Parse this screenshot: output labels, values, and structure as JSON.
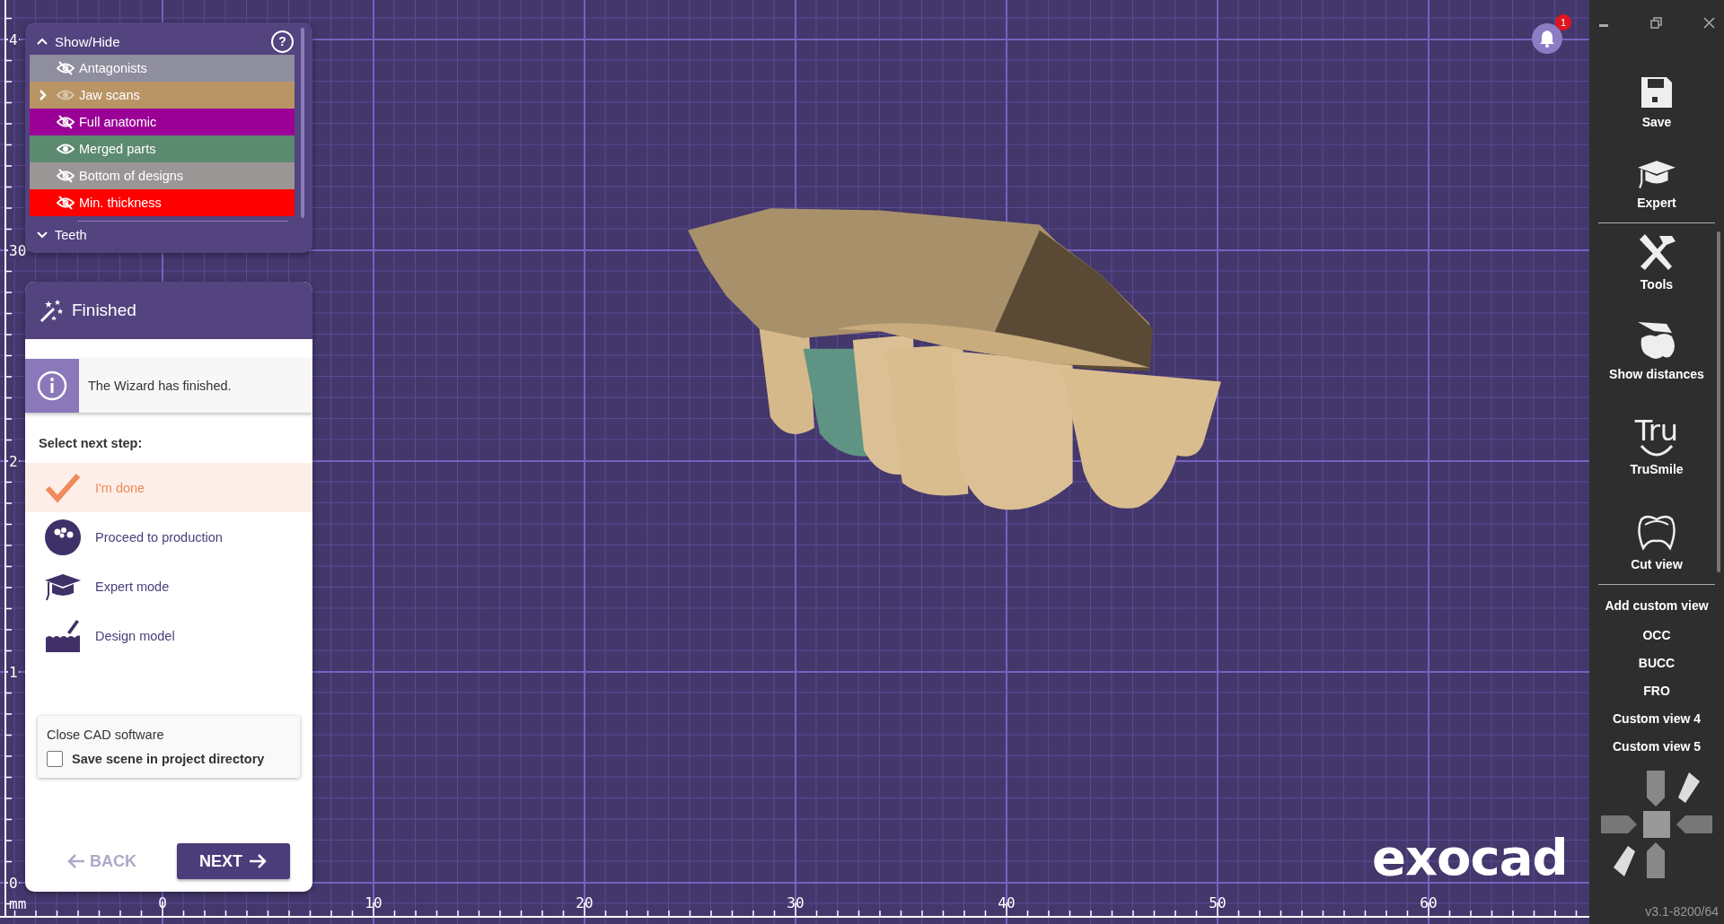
{
  "layers_panel": {
    "title": "Show/Hide",
    "expanded": true,
    "help_icon": "?",
    "items": [
      {
        "label": "Antagonists",
        "color": "#8e8e9e",
        "visible": false,
        "dimmed": false,
        "expandable": false
      },
      {
        "label": "Jaw scans",
        "color": "#b99566",
        "visible": true,
        "dimmed": true,
        "expandable": true
      },
      {
        "label": "Full anatomic",
        "color": "#9b0096",
        "visible": false,
        "dimmed": false,
        "expandable": false
      },
      {
        "label": "Merged parts",
        "color": "#5c8a70",
        "visible": true,
        "dimmed": false,
        "expandable": false
      },
      {
        "label": "Bottom of designs",
        "color": "#9a9696",
        "visible": false,
        "dimmed": false,
        "expandable": false
      },
      {
        "label": "Min. thickness",
        "color": "#ff0000",
        "visible": false,
        "dimmed": false,
        "expandable": false
      }
    ],
    "sections": [
      {
        "label": "Teeth",
        "expanded": false
      }
    ]
  },
  "wizard": {
    "title": "Finished",
    "info": "The Wizard has finished.",
    "prompt": "Select next step:",
    "options": [
      {
        "label": "I'm done",
        "kind": "done",
        "selected": true
      },
      {
        "label": "Proceed to production",
        "kind": "production",
        "selected": false
      },
      {
        "label": "Expert mode",
        "kind": "expert",
        "selected": false
      },
      {
        "label": "Design model",
        "kind": "design",
        "selected": false
      }
    ],
    "close_box": {
      "title": "Close CAD software",
      "checkbox": {
        "label": "Save scene in project directory",
        "checked": false
      }
    },
    "back": {
      "label": "BACK",
      "disabled": true
    },
    "next": {
      "label": "NEXT",
      "disabled": false
    }
  },
  "viewport": {
    "y_labels": [
      "4",
      "30",
      "2",
      "1",
      "0"
    ],
    "x_labels": [
      "0",
      "10",
      "20",
      "30",
      "40",
      "50",
      "60"
    ],
    "unit": "mm",
    "logo": "exocad",
    "notifications": "1"
  },
  "sidebar": {
    "tools": [
      {
        "label": "Save",
        "kind": "save"
      },
      {
        "label": "Expert",
        "kind": "expert"
      },
      {
        "label": "Tools",
        "kind": "tools"
      },
      {
        "label": "Show distances",
        "kind": "distances"
      },
      {
        "label": "TruSmile",
        "kind": "trusmile",
        "logo_text": "Tru"
      },
      {
        "label": "Cut view",
        "kind": "cutview"
      }
    ],
    "custom_views_title": "Add custom view",
    "views": [
      "OCC",
      "BUCC",
      "FRO",
      "Custom view 4",
      "Custom view 5"
    ],
    "version": "v3.1-8200/64"
  }
}
